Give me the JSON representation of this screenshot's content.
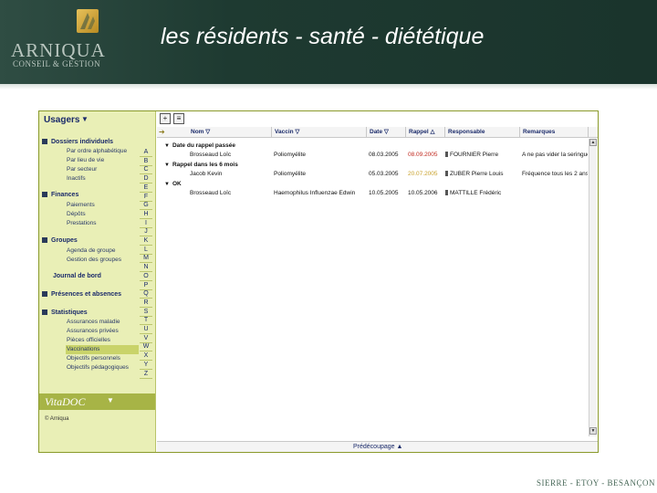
{
  "slide": {
    "title": "les résidents - santé - diététique",
    "logo_name": "ARNIQUA",
    "logo_sub": "CONSEIL & GESTION",
    "footer": "SIERRE - ETOY - BESANÇON"
  },
  "sidebar": {
    "title": "Usagers",
    "sections": [
      {
        "label": "Dossiers individuels",
        "items": [
          "Par ordre alphabétique",
          "Par lieu de vie",
          "Par secteur",
          "Inactifs"
        ]
      },
      {
        "label": "Finances",
        "items": [
          "Paiements",
          "Dépôts",
          "Prestations"
        ]
      },
      {
        "label": "Groupes",
        "items": [
          "Agenda de groupe",
          "Gestion des groupes"
        ]
      },
      {
        "label": "Journal de bord",
        "items": []
      },
      {
        "label": "Présences et absences",
        "items": []
      },
      {
        "label": "Statistiques",
        "items": [
          "Assurances maladie",
          "Assurances privées",
          "Pièces officielles",
          "Vaccinations",
          "Objectifs personnels",
          "Objectifs pédagogiques"
        ]
      }
    ],
    "selected_item": "Vaccinations",
    "letters": [
      "A",
      "B",
      "C",
      "D",
      "E",
      "F",
      "G",
      "H",
      "I",
      "J",
      "K",
      "L",
      "M",
      "N",
      "O",
      "P",
      "Q",
      "R",
      "S",
      "T",
      "U",
      "V",
      "W",
      "X",
      "Y",
      "Z"
    ],
    "brand": "VitaDOC",
    "copyright": "© Arniqua"
  },
  "table": {
    "columns": [
      "Nom",
      "Vaccin",
      "Date",
      "Rappel",
      "Responsable",
      "Remarques"
    ],
    "groups": [
      {
        "label": "Date du rappel passée",
        "rows": [
          {
            "nom": "Brosseaud Loïc",
            "vaccin": "Poliomyélite",
            "date": "08.03.2005",
            "rappel": "08.09.2005",
            "rappel_status": "overdue",
            "responsable": "FOURNIER Pierre",
            "remarques": "A ne pas vider la seringue"
          }
        ]
      },
      {
        "label": "Rappel dans les 6 mois",
        "rows": [
          {
            "nom": "Jacob Kevin",
            "vaccin": "Poliomyélite",
            "date": "05.03.2005",
            "rappel": "20.07.2005",
            "rappel_status": "upcoming",
            "responsable": "ZUBER Pierre Louis",
            "remarques": "Fréquence tous les 2 ans"
          }
        ]
      },
      {
        "label": "OK",
        "rows": [
          {
            "nom": "Brosseaud Loïc",
            "vaccin": "Haemophilus Influenzae Edwin",
            "date": "10.05.2005",
            "rappel": "10.05.2006",
            "rappel_status": "ok",
            "responsable": "MATTILLE Frédéric",
            "remarques": ""
          }
        ]
      }
    ],
    "status": "Prédécoupage"
  },
  "colors": {
    "header_bg": "#1e3a31",
    "sidebar_bg": "#e9efb6",
    "accent": "#a7b446",
    "overdue": "#c0281e",
    "upcoming": "#c8a02a"
  }
}
